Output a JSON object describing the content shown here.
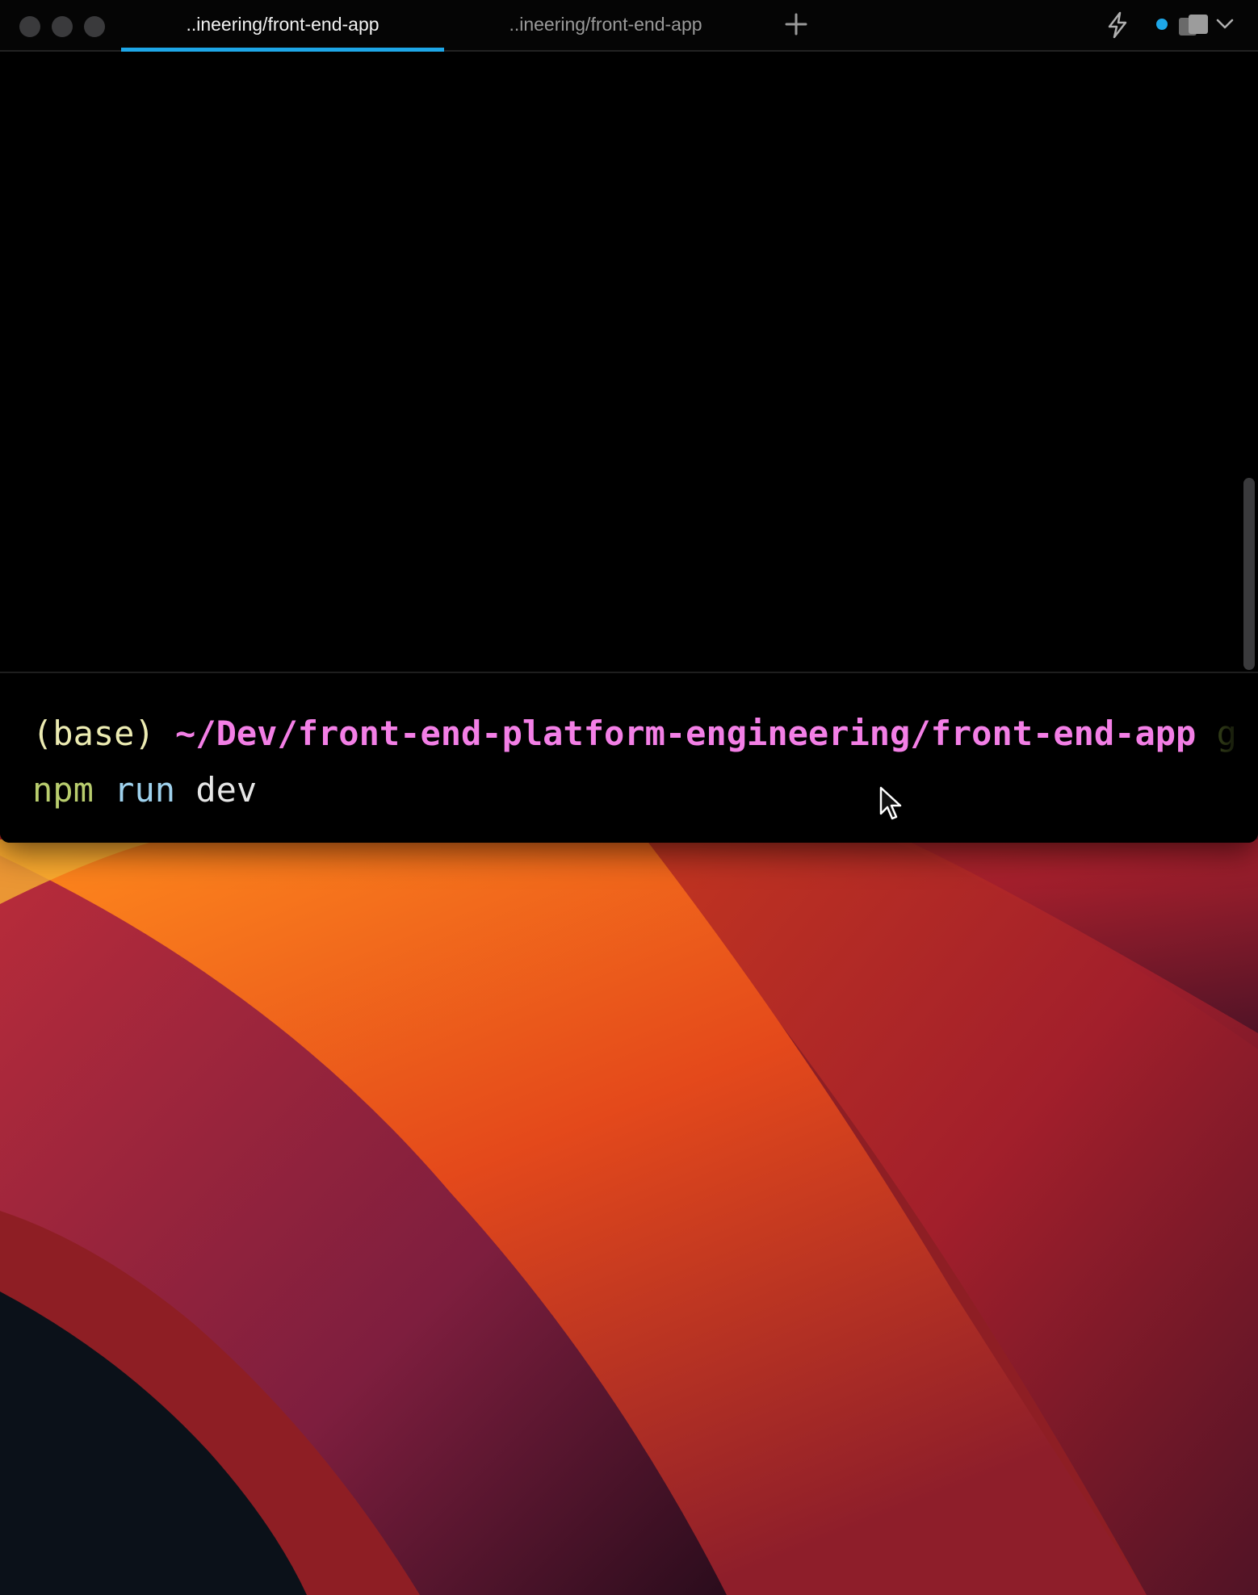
{
  "window": {
    "tabs": [
      {
        "label": "..ineering/front-end-app",
        "active": true
      },
      {
        "label": "..ineering/front-end-app",
        "active": false
      }
    ],
    "new_tab_icon": "plus-icon",
    "right_icons": [
      "bolt-icon",
      "status-dot-icon",
      "pane-icon",
      "chevron-down-icon"
    ]
  },
  "terminal": {
    "prompt": {
      "env": "(base)",
      "path": "~/Dev/front-end-platform-engineering/front-end-app",
      "git": "g"
    },
    "command": {
      "program": "npm",
      "subcommand": "run",
      "arg": "dev"
    }
  },
  "colors": {
    "accent": "#1ea7e8",
    "prompt_env": "#ecebb2",
    "prompt_path": "#f37fe6",
    "cmd_npm": "#b9cd6e",
    "cmd_run": "#9fd2ee",
    "cmd_dev": "#e6e6e6"
  }
}
